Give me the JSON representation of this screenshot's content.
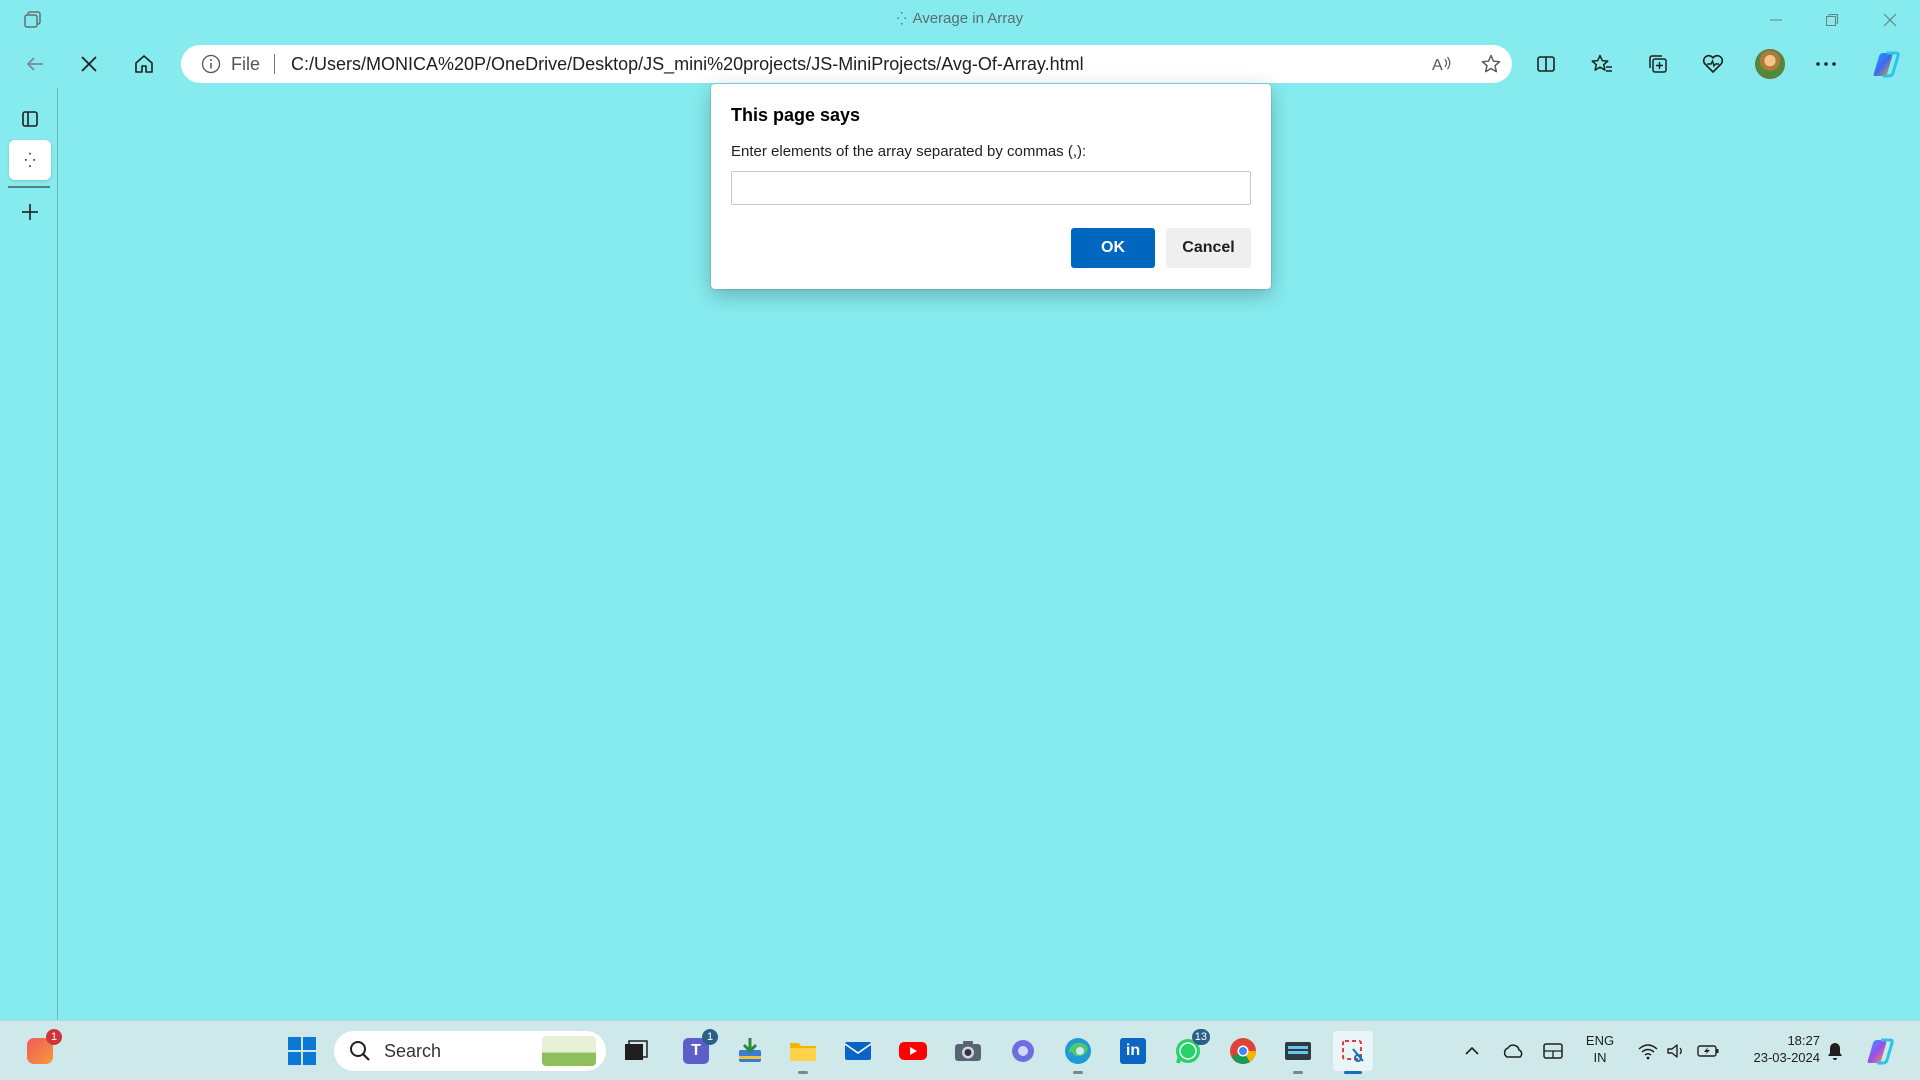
{
  "window": {
    "title": "Average in Array"
  },
  "address_bar": {
    "scheme_label": "File",
    "url": "C:/Users/MONICA%20P/OneDrive/Desktop/JS_mini%20projects/JS-MiniProjects/Avg-Of-Array.html"
  },
  "dialog": {
    "title": "This page says",
    "message": "Enter elements of the array separated by commas (,):",
    "input_value": "",
    "ok_label": "OK",
    "cancel_label": "Cancel"
  },
  "taskbar": {
    "search_label": "Search",
    "widgets_badge": "1",
    "teams_badge": "1",
    "whatsapp_badge": "13",
    "lang_line1": "ENG",
    "lang_line2": "IN",
    "time": "18:27",
    "date": "23-03-2024"
  },
  "icons": [
    "workspaces-icon",
    "loading-spinner-icon",
    "minimize-icon",
    "restore-icon",
    "close-icon",
    "back-arrow-icon",
    "stop-loading-icon",
    "home-icon",
    "info-icon",
    "read-aloud-icon",
    "favorite-star-icon",
    "split-screen-icon",
    "favorites-icon",
    "collections-icon",
    "browser-essentials-icon",
    "profile-avatar",
    "more-options-icon",
    "copilot-icon",
    "tab-actions-icon",
    "new-tab-icon",
    "windows-start-icon",
    "search-icon"
  ],
  "colors": {
    "page_background": "#86ebee",
    "ok_button": "#0067c0",
    "taskbar": "#cfe9ea"
  }
}
